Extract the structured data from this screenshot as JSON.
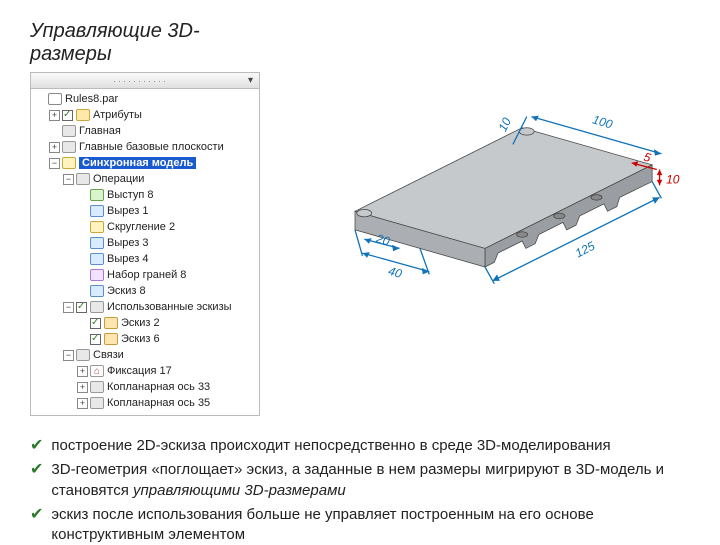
{
  "title": "Управляющие 3D-размеры",
  "tree": {
    "root": "Rules8.par",
    "items": {
      "attrs": "Атрибуты",
      "main": "Главная",
      "planes": "Главные базовые плоскости",
      "sync": "Синхронная модель",
      "ops": "Операции",
      "ext8": "Выступ 8",
      "cut1": "Вырез 1",
      "round2": "Скругление 2",
      "cut3": "Вырез 3",
      "cut4": "Вырез 4",
      "faces8": "Набор граней 8",
      "sk8": "Эскиз 8",
      "usedsk": "Использованные эскизы",
      "sk2": "Эскиз 2",
      "sk6": "Эскиз 6",
      "rel": "Связи",
      "fix17": "Фиксация 17",
      "coax33": "Копланарная ось 33",
      "coax35": "Копланарная ось 35"
    }
  },
  "dims": {
    "d10a": "10",
    "d100": "100",
    "d5": "5",
    "d10b": "10",
    "d125": "125",
    "d40": "40",
    "d20": "20"
  },
  "bullets": {
    "b1": "построение 2D-эскиза происходит непосредственно в среде 3D-моделирования",
    "b2a": "3D-геометрия «поглощает» эскиз, а заданные в нем размеры мигрируют в 3D-модель и становятся ",
    "b2em": "управляющими 3D-размерами",
    "b3": "эскиз после использования больше не управляет построенным на его основе конструктивным элементом"
  }
}
